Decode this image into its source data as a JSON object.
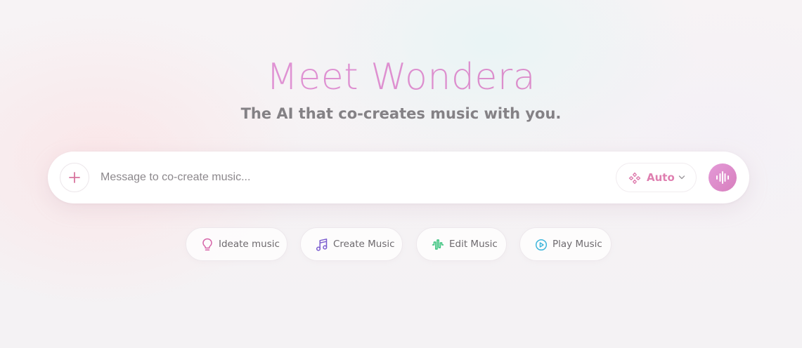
{
  "hero": {
    "title": "Meet Wondera",
    "subtitle": "The AI that co-creates music with you."
  },
  "composer": {
    "placeholder": "Message to co-create music...",
    "value": "",
    "add_icon": "plus-icon",
    "mode": {
      "label": "Auto",
      "icon": "sparkle-diamond-icon"
    },
    "voice_icon": "voice-waveform-icon"
  },
  "chips": [
    {
      "label": "Ideate music",
      "icon": "lightbulb-icon",
      "color": "#d663a8"
    },
    {
      "label": "Create Music",
      "icon": "music-note-icon",
      "color": "#7b5ccf"
    },
    {
      "label": "Edit Music",
      "icon": "waveform-icon",
      "color": "#35c17a"
    },
    {
      "label": "Play Music",
      "icon": "play-circle-icon",
      "color": "#3eb6dc"
    }
  ],
  "colors": {
    "accent_pink": "#df7fb0",
    "title_gradient_start": "#e497dc",
    "subtitle": "#848185"
  }
}
